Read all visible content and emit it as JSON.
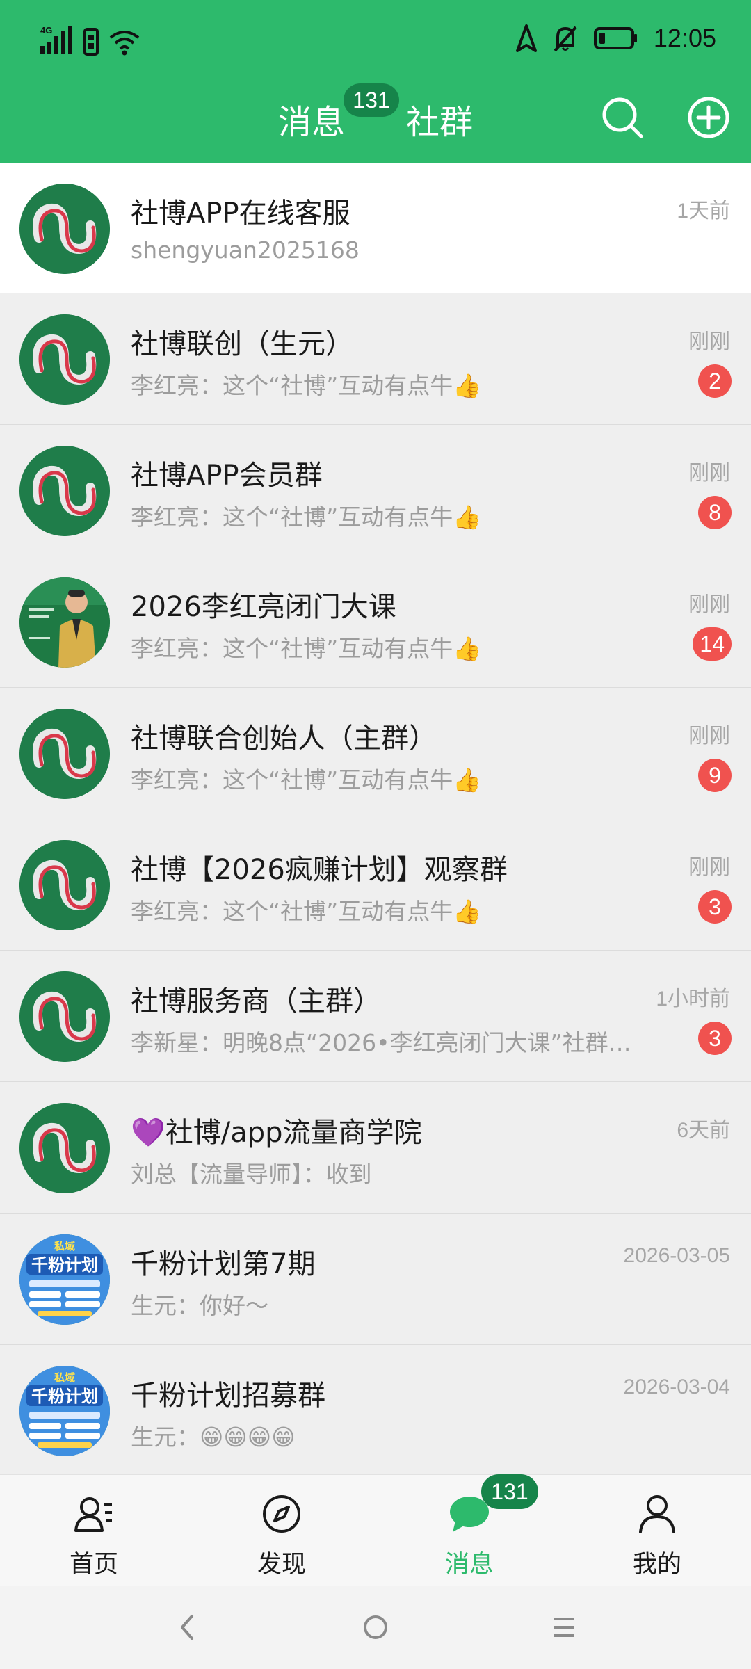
{
  "status_bar": {
    "network_label": "4G",
    "time": "12:05"
  },
  "header": {
    "tab_messages": "消息",
    "tab_groups": "社群",
    "messages_badge": "131",
    "icons": [
      "search-icon",
      "add-circle-icon"
    ]
  },
  "conversations": [
    {
      "name": "社博APP在线客服",
      "preview": "shengyuan2025168",
      "time": "1天前",
      "unread": "",
      "avatar": "logo",
      "pinned": true
    },
    {
      "name": "社博联创（生元）",
      "preview": "李红亮：这个“社博”互动有点牛👍",
      "time": "刚刚",
      "unread": "2",
      "avatar": "logo",
      "pinned": false
    },
    {
      "name": "社博APP会员群",
      "preview": "李红亮：这个“社博”互动有点牛👍",
      "time": "刚刚",
      "unread": "8",
      "avatar": "logo",
      "pinned": false
    },
    {
      "name": "2026李红亮闭门大课",
      "preview": "李红亮：这个“社博”互动有点牛👍",
      "time": "刚刚",
      "unread": "14",
      "avatar": "photo",
      "pinned": false
    },
    {
      "name": "社博联合创始人（主群）",
      "preview": "李红亮：这个“社博”互动有点牛👍",
      "time": "刚刚",
      "unread": "9",
      "avatar": "logo",
      "pinned": false
    },
    {
      "name": "社博【2026疯赚计划】观察群",
      "preview": "李红亮：这个“社博”互动有点牛👍",
      "time": "刚刚",
      "unread": "3",
      "avatar": "logo",
      "pinned": false
    },
    {
      "name": "社博服务商（主群）",
      "preview": "李新星：明晚8点“2026•李红亮闭门大课”社群…",
      "time": "1小时前",
      "unread": "3",
      "avatar": "logo",
      "pinned": false
    },
    {
      "name": "💜社博/app流量商学院",
      "preview": "刘总【流量导师】：收到",
      "time": "6天前",
      "unread": "",
      "avatar": "logo",
      "pinned": false
    },
    {
      "name": "千粉计划第7期",
      "preview": "生元：你好～",
      "time": "2026-03-05",
      "unread": "",
      "avatar": "poster",
      "pinned": false
    },
    {
      "name": "千粉计划招募群",
      "preview": "生元：😁😁😁😁",
      "time": "2026-03-04",
      "unread": "",
      "avatar": "poster",
      "pinned": false
    }
  ],
  "poster_text": "千粉计划",
  "poster_tag": "私域",
  "tabbar": {
    "home": "首页",
    "discover": "发现",
    "messages": "消息",
    "mine": "我的",
    "messages_badge": "131",
    "active": "messages",
    "accent_color": "#2dba6c"
  },
  "colors": {
    "header_bg": "#2dba6c",
    "badge_green": "#16844a",
    "badge_red": "#f0524f"
  }
}
